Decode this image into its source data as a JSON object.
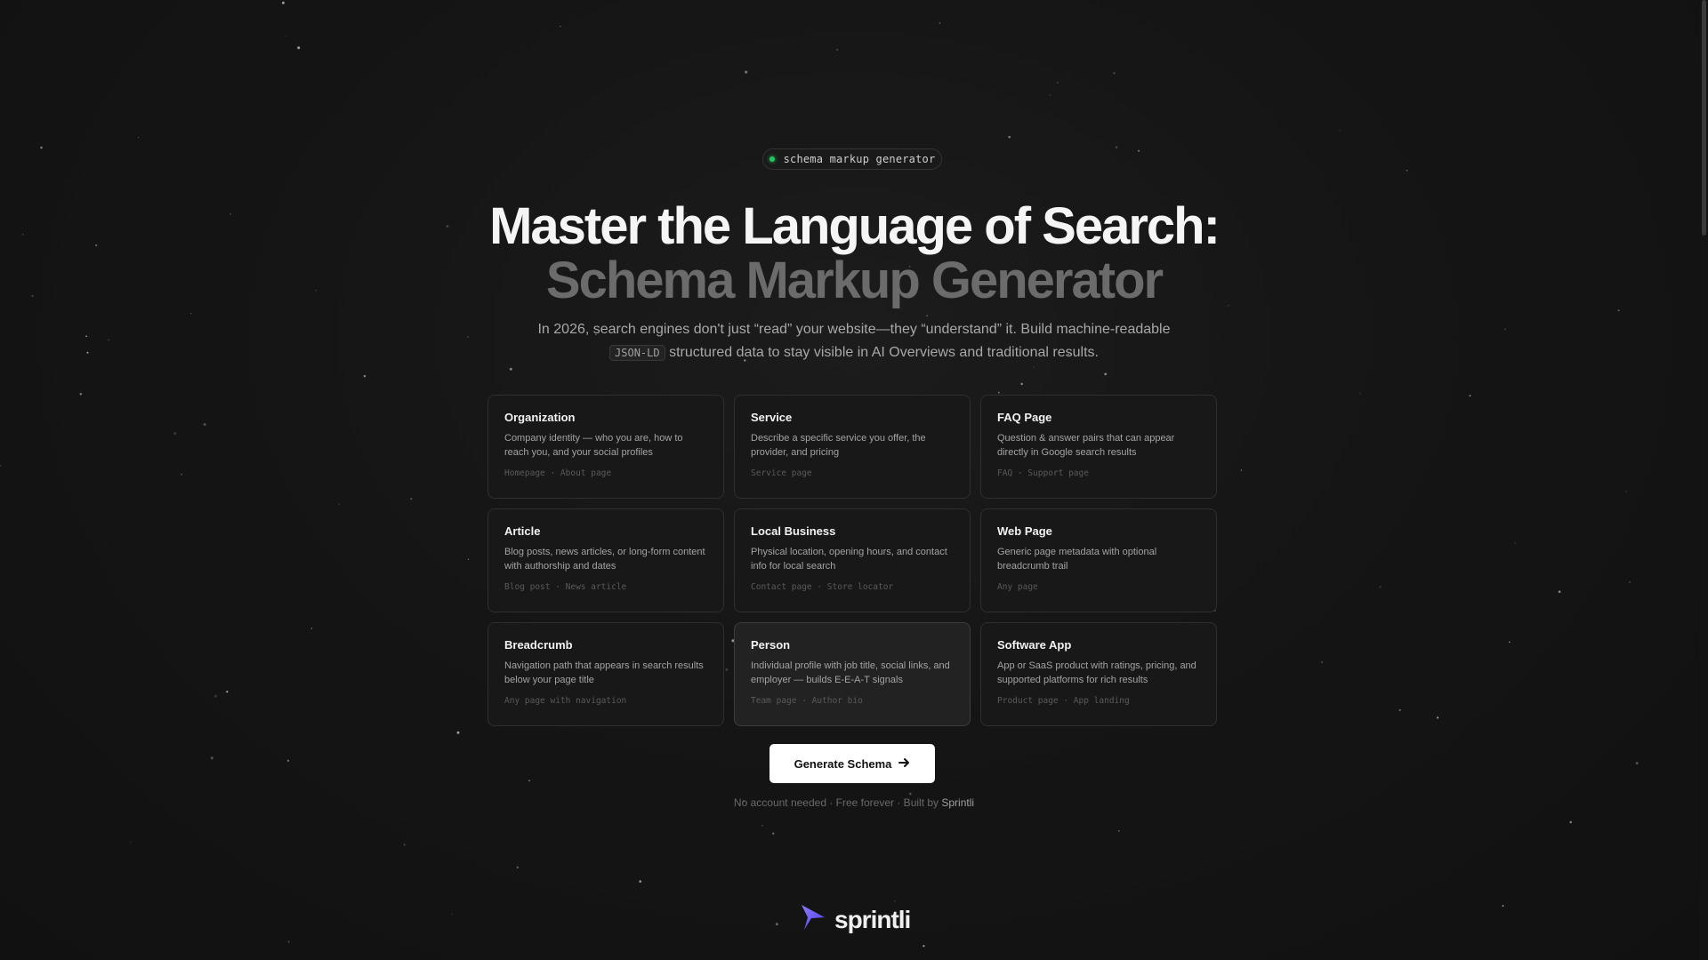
{
  "badge": {
    "text": "schema markup generator",
    "dot_color": "#22c55e"
  },
  "hero": {
    "title_line1": "Master the Language of Search:",
    "title_line2": "Schema Markup Generator",
    "subtitle_before": "In 2026, search engines don't just “read” your website—they “understand” it. Build machine-readable",
    "subtitle_code": "JSON-LD",
    "subtitle_after": "structured data to stay visible in AI Overviews and traditional results."
  },
  "schema_types": [
    {
      "title": "Organization",
      "description": "Company identity — who you are, how to reach you, and your social profiles",
      "tags": "Homepage · About page",
      "highlighted": false
    },
    {
      "title": "Service",
      "description": "Describe a specific service you offer, the provider, and pricing",
      "tags": "Service page",
      "highlighted": false
    },
    {
      "title": "FAQ Page",
      "description": "Question & answer pairs that can appear directly in Google search results",
      "tags": "FAQ · Support page",
      "highlighted": false
    },
    {
      "title": "Article",
      "description": "Blog posts, news articles, or long-form content with authorship and dates",
      "tags": "Blog post · News article",
      "highlighted": false
    },
    {
      "title": "Local Business",
      "description": "Physical location, opening hours, and contact info for local search",
      "tags": "Contact page · Store locator",
      "highlighted": false
    },
    {
      "title": "Web Page",
      "description": "Generic page metadata with optional breadcrumb trail",
      "tags": "Any page",
      "highlighted": false
    },
    {
      "title": "Breadcrumb",
      "description": "Navigation path that appears in search results below your page title",
      "tags": "Any page with navigation",
      "highlighted": false
    },
    {
      "title": "Person",
      "description": "Individual profile with job title, social links, and employer — builds E-E-A-T signals",
      "tags": "Team page · Author bio",
      "highlighted": true
    },
    {
      "title": "Software App",
      "description": "App or SaaS product with ratings, pricing, and supported platforms for rich results",
      "tags": "Product page · App landing",
      "highlighted": false
    }
  ],
  "cta": {
    "label": "Generate Schema",
    "icon": "arrow-right-icon"
  },
  "footnote": {
    "text": "No account needed · Free forever · Built by ",
    "brand": "Sprintli"
  },
  "logo": {
    "text": "sprintli",
    "icon": "lightning-icon",
    "color": "#6d5dfc"
  }
}
